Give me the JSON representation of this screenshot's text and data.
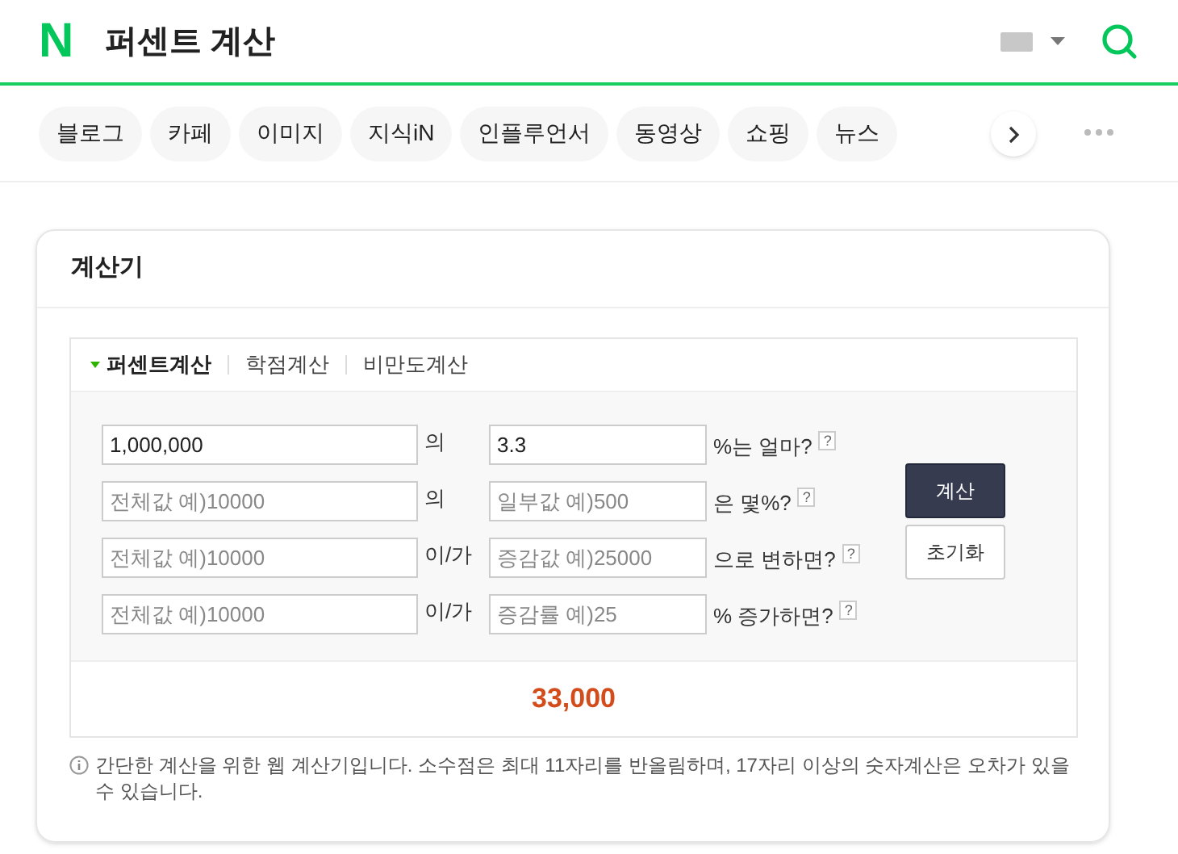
{
  "header": {
    "logo": "N",
    "query": "퍼센트 계산"
  },
  "nav_tabs": [
    {
      "label": "블로그"
    },
    {
      "label": "카페"
    },
    {
      "label": "이미지"
    },
    {
      "label": "지식iN"
    },
    {
      "label": "인플루언서"
    },
    {
      "label": "동영상"
    },
    {
      "label": "쇼핑"
    },
    {
      "label": "뉴스"
    }
  ],
  "calculator": {
    "title": "계산기",
    "tabs": [
      {
        "label": "퍼센트계산",
        "selected": true
      },
      {
        "label": "학점계산",
        "selected": false
      },
      {
        "label": "비만도계산",
        "selected": false
      }
    ],
    "rows": [
      {
        "first": {
          "value": "1,000,000"
        },
        "particle": "의",
        "second": {
          "value": "3.3"
        },
        "suffix": "%는 얼마?",
        "help": "?"
      },
      {
        "first": {
          "placeholder": "전체값 예)10000"
        },
        "particle": "의",
        "second": {
          "placeholder": "일부값 예)500"
        },
        "suffix": "은 몇%?",
        "help": "?"
      },
      {
        "first": {
          "placeholder": "전체값 예)10000"
        },
        "particle": "이/가",
        "second": {
          "placeholder": "증감값 예)25000"
        },
        "suffix": "으로 변하면?",
        "help": "?"
      },
      {
        "first": {
          "placeholder": "전체값 예)10000"
        },
        "particle": "이/가",
        "second": {
          "placeholder": "증감률 예)25"
        },
        "suffix": "% 증가하면?",
        "help": "?"
      }
    ],
    "buttons": [
      {
        "label": "계산",
        "kind": "primary"
      },
      {
        "label": "초기화",
        "kind": "secondary"
      }
    ],
    "result": "33,000",
    "note": "간단한 계산을 위한 웹 계산기입니다. 소수점은 최대 11자리를 반올림하며, 17자리 이상의 숫자계산은 오차가 있을 수 있습니다."
  }
}
